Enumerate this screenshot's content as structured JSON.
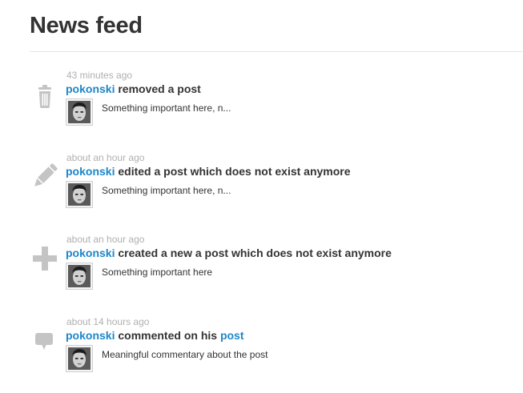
{
  "page": {
    "title": "News feed"
  },
  "feed": {
    "items": [
      {
        "icon": "trash-icon",
        "timestamp": "43 minutes ago",
        "user": "pokonski",
        "action": "removed a post",
        "snippet": "Something important here, n..."
      },
      {
        "icon": "pencil-icon",
        "timestamp": "about an hour ago",
        "user": "pokonski",
        "action": "edited a post which does not exist anymore",
        "snippet": "Something important here, n..."
      },
      {
        "icon": "plus-icon",
        "timestamp": "about an hour ago",
        "user": "pokonski",
        "action": "created a new a post which does not exist anymore",
        "snippet": "Something important here"
      },
      {
        "icon": "comment-icon",
        "timestamp": "about 14 hours ago",
        "user": "pokonski",
        "action": "commented on his",
        "action_link": "post",
        "snippet": "Meaningful commentary about the post"
      }
    ]
  },
  "colors": {
    "link": "#1e87c9",
    "text": "#333333",
    "timestamp": "#b0b0b0",
    "icon": "#c4c4c4"
  }
}
